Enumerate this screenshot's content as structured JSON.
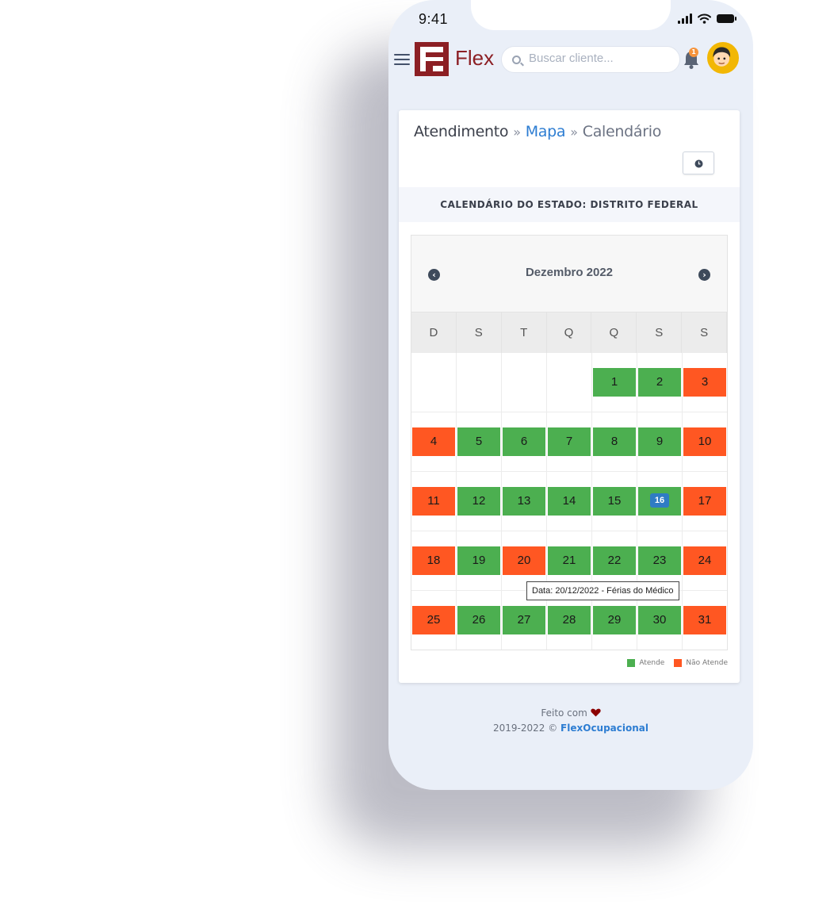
{
  "status": {
    "time": "9:41"
  },
  "header": {
    "logo_text": "Flex",
    "search_placeholder": "Buscar cliente...",
    "notification_count": "1"
  },
  "breadcrumb": {
    "item1": "Atendimento",
    "sep1": "»",
    "item2": "Mapa",
    "sep2": "»",
    "item3": "Calendário"
  },
  "section_title": "CALENDÁRIO DO ESTADO: DISTRITO FEDERAL",
  "calendar": {
    "month": "Dezembro 2022",
    "prev": "‹",
    "next": "›",
    "weekdays": [
      "D",
      "S",
      "T",
      "Q",
      "Q",
      "S",
      "S"
    ],
    "days": [
      {
        "n": "1",
        "s": "green"
      },
      {
        "n": "2",
        "s": "green"
      },
      {
        "n": "3",
        "s": "orange"
      },
      {
        "n": "4",
        "s": "orange"
      },
      {
        "n": "5",
        "s": "green"
      },
      {
        "n": "6",
        "s": "green"
      },
      {
        "n": "7",
        "s": "green"
      },
      {
        "n": "8",
        "s": "green"
      },
      {
        "n": "9",
        "s": "green"
      },
      {
        "n": "10",
        "s": "orange"
      },
      {
        "n": "11",
        "s": "orange"
      },
      {
        "n": "12",
        "s": "green"
      },
      {
        "n": "13",
        "s": "green"
      },
      {
        "n": "14",
        "s": "green"
      },
      {
        "n": "15",
        "s": "green"
      },
      {
        "n": "16",
        "s": "green",
        "today": true
      },
      {
        "n": "17",
        "s": "orange"
      },
      {
        "n": "18",
        "s": "orange"
      },
      {
        "n": "19",
        "s": "green"
      },
      {
        "n": "20",
        "s": "orange"
      },
      {
        "n": "21",
        "s": "green"
      },
      {
        "n": "22",
        "s": "green"
      },
      {
        "n": "23",
        "s": "green"
      },
      {
        "n": "24",
        "s": "orange"
      },
      {
        "n": "25",
        "s": "orange"
      },
      {
        "n": "26",
        "s": "green"
      },
      {
        "n": "27",
        "s": "green"
      },
      {
        "n": "28",
        "s": "green"
      },
      {
        "n": "29",
        "s": "green"
      },
      {
        "n": "30",
        "s": "green"
      },
      {
        "n": "31",
        "s": "orange"
      }
    ],
    "tooltip": "Data: 20/12/2022 - Férias do Médico"
  },
  "legend": {
    "attends": "Atende",
    "not_attends": "Não Atende"
  },
  "colors": {
    "attends": "#4caf50",
    "not_attends": "#ff5722",
    "accent": "#2d7dd2",
    "brand": "#8c1f24"
  },
  "footer": {
    "made_with": "Feito com",
    "copyright": "2019-2022 ©",
    "brand": "FlexOcupacional"
  }
}
